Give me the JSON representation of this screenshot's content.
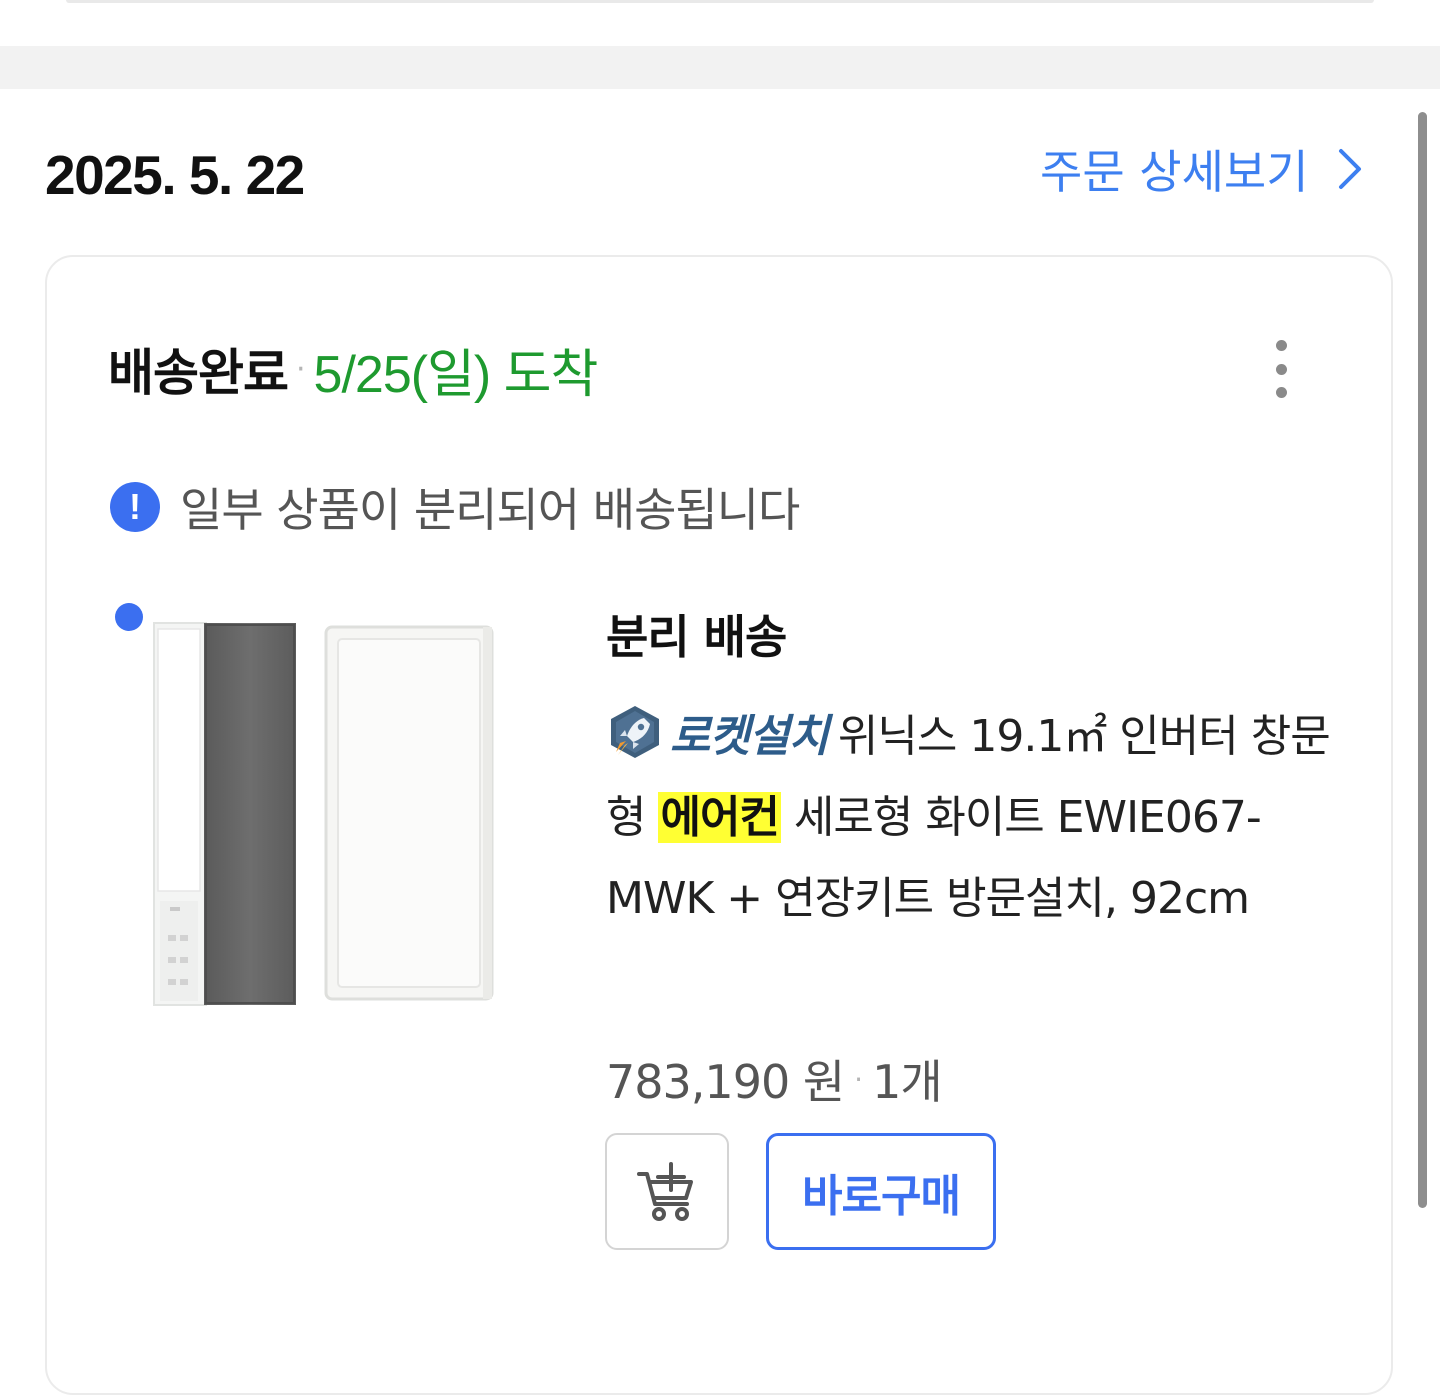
{
  "order": {
    "date": "2025. 5. 22",
    "detail_link_label": "주문 상세보기"
  },
  "shipment": {
    "status_label": "배송완료",
    "separator": "·",
    "arrival_text": "5/25(일) 도착",
    "notice_text": "일부 상품이 분리되어 배송됩니다",
    "notice_icon_glyph": "!",
    "split_title": "분리 배송"
  },
  "product": {
    "badge_label": "로켓설치",
    "name_part1": "위닉스 19.1㎡ 인버터 창문형 ",
    "name_highlight": "에어컨",
    "name_part2": " 세로형 화이트 EWIE067-MWK + 연장키트 방문설치, 92cm",
    "price": "783,190 원",
    "price_separator": "·",
    "quantity": "1개"
  },
  "actions": {
    "buy_now_label": "바로구매"
  },
  "colors": {
    "accent_blue": "#3b6ff0",
    "link_blue": "#3d7ff0",
    "arrival_green": "#1e9a2f",
    "highlight_yellow": "#ffff33"
  },
  "icons": {
    "detail_chevron": "chevron-right-icon",
    "more_menu": "kebab-menu-icon",
    "notice": "info-exclamation-icon",
    "rocket_badge": "rocket-badge-icon",
    "cart_add": "cart-add-icon"
  }
}
